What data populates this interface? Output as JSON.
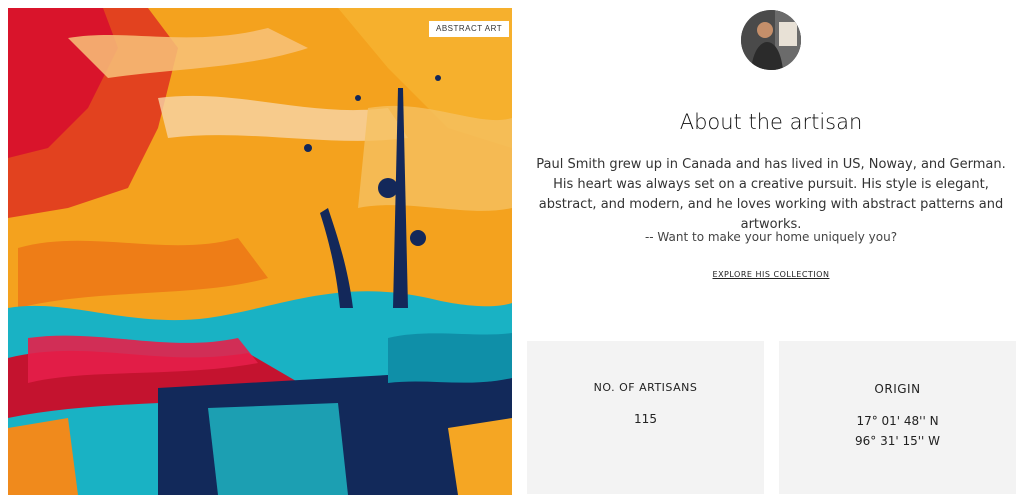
{
  "image": {
    "tag": "ABSTRACT ART"
  },
  "artisan": {
    "heading": "About the artisan",
    "bio": "Paul Smith grew up in Canada and has lived in US, Noway, and German. His heart was always set on a creative pursuit. His style is elegant, abstract, and modern, and he loves working with abstract patterns and artworks.",
    "quote": "-- Want to make your home uniquely you?",
    "explore_link": "EXPLORE HIS COLLECTION"
  },
  "stats": {
    "artisans": {
      "title": "NO. OF ARTISANS",
      "value": "115"
    },
    "origin": {
      "title": "ORIGIN",
      "lat": "17° 01' 48'' N",
      "lon": "96° 31' 15'' W"
    }
  },
  "colors": {
    "card_bg": "#f3f3f3",
    "paint_orange": "#f5a623",
    "paint_red": "#d9142b",
    "paint_teal": "#1ea7b8",
    "paint_navy": "#13285a"
  }
}
